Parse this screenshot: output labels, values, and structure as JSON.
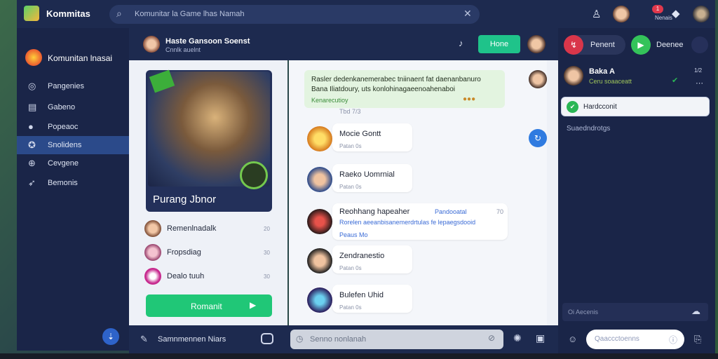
{
  "app": {
    "title": "Kommitas"
  },
  "search": {
    "placeholder": "Komunitar la Game lhas Namah"
  },
  "sidebar": {
    "group_name": "Komunitan lnasai",
    "items": [
      {
        "label": "Pangenies",
        "icon": "compass-icon"
      },
      {
        "label": "Gabeno",
        "icon": "list-icon"
      },
      {
        "label": "Popeaoc",
        "icon": "chat-icon"
      },
      {
        "label": "Snolidens",
        "icon": "users-icon",
        "active": true
      },
      {
        "label": "Cevgene",
        "icon": "gamepad-icon"
      },
      {
        "label": "Bemonis",
        "icon": "rocket-icon"
      }
    ]
  },
  "conversation": {
    "name": "Haste Gansoon Soenst",
    "subtitle": "Cnnlk auelnt",
    "home_label": "Hone"
  },
  "profile": {
    "card_title": "Purang Jbnor",
    "members": [
      {
        "name": "Remenlnadalk",
        "count": "20"
      },
      {
        "name": "Fropsdiag",
        "count": "30"
      },
      {
        "name": "Dealo tuuh",
        "count": "30"
      }
    ],
    "join_label": "Romanit"
  },
  "chat": {
    "pinned": {
      "line1": "Rasler dedenkanemerabec tniinaent fat daenanbanuro",
      "line2": "Bana Iliatdoury, uts konlohinagaeenoahenaboi",
      "line3": "Kenarecutioy",
      "time": "Tbd 7/3"
    },
    "messages": [
      {
        "name": "Mocie Gontt",
        "time": "Patan 0s"
      },
      {
        "name": "Raeko Uomrnial",
        "time": "Patan 0s"
      },
      {
        "name": "Reohhang hapeaher",
        "tag": "Pandooatal",
        "time": "70",
        "text1": "Rorelen aeeanbisanemerdrtulas fe lepaegsdooid",
        "text2": "Peaus Mo"
      },
      {
        "name": "Zendranestio",
        "time": "Patan 0s"
      },
      {
        "name": "Bulefen Uhid",
        "time": "Patan 0s"
      }
    ]
  },
  "input": {
    "comment_label": "Samnmennen Niars",
    "placeholder": "Senno nonlanah"
  },
  "right_panel": {
    "btn1_label": "Penent",
    "btn2_label": "Deenee",
    "user_name": "Baka A",
    "user_sub": "Ceru soaaceatt",
    "user_count": "1/2",
    "card_label": "Hardcconit",
    "section_title": "Suaedndrotgs",
    "bottom_input": "Oi Aecenis",
    "compose_placeholder": "Qaaccctoenns"
  },
  "topbar": {
    "notification_badge": "1"
  }
}
